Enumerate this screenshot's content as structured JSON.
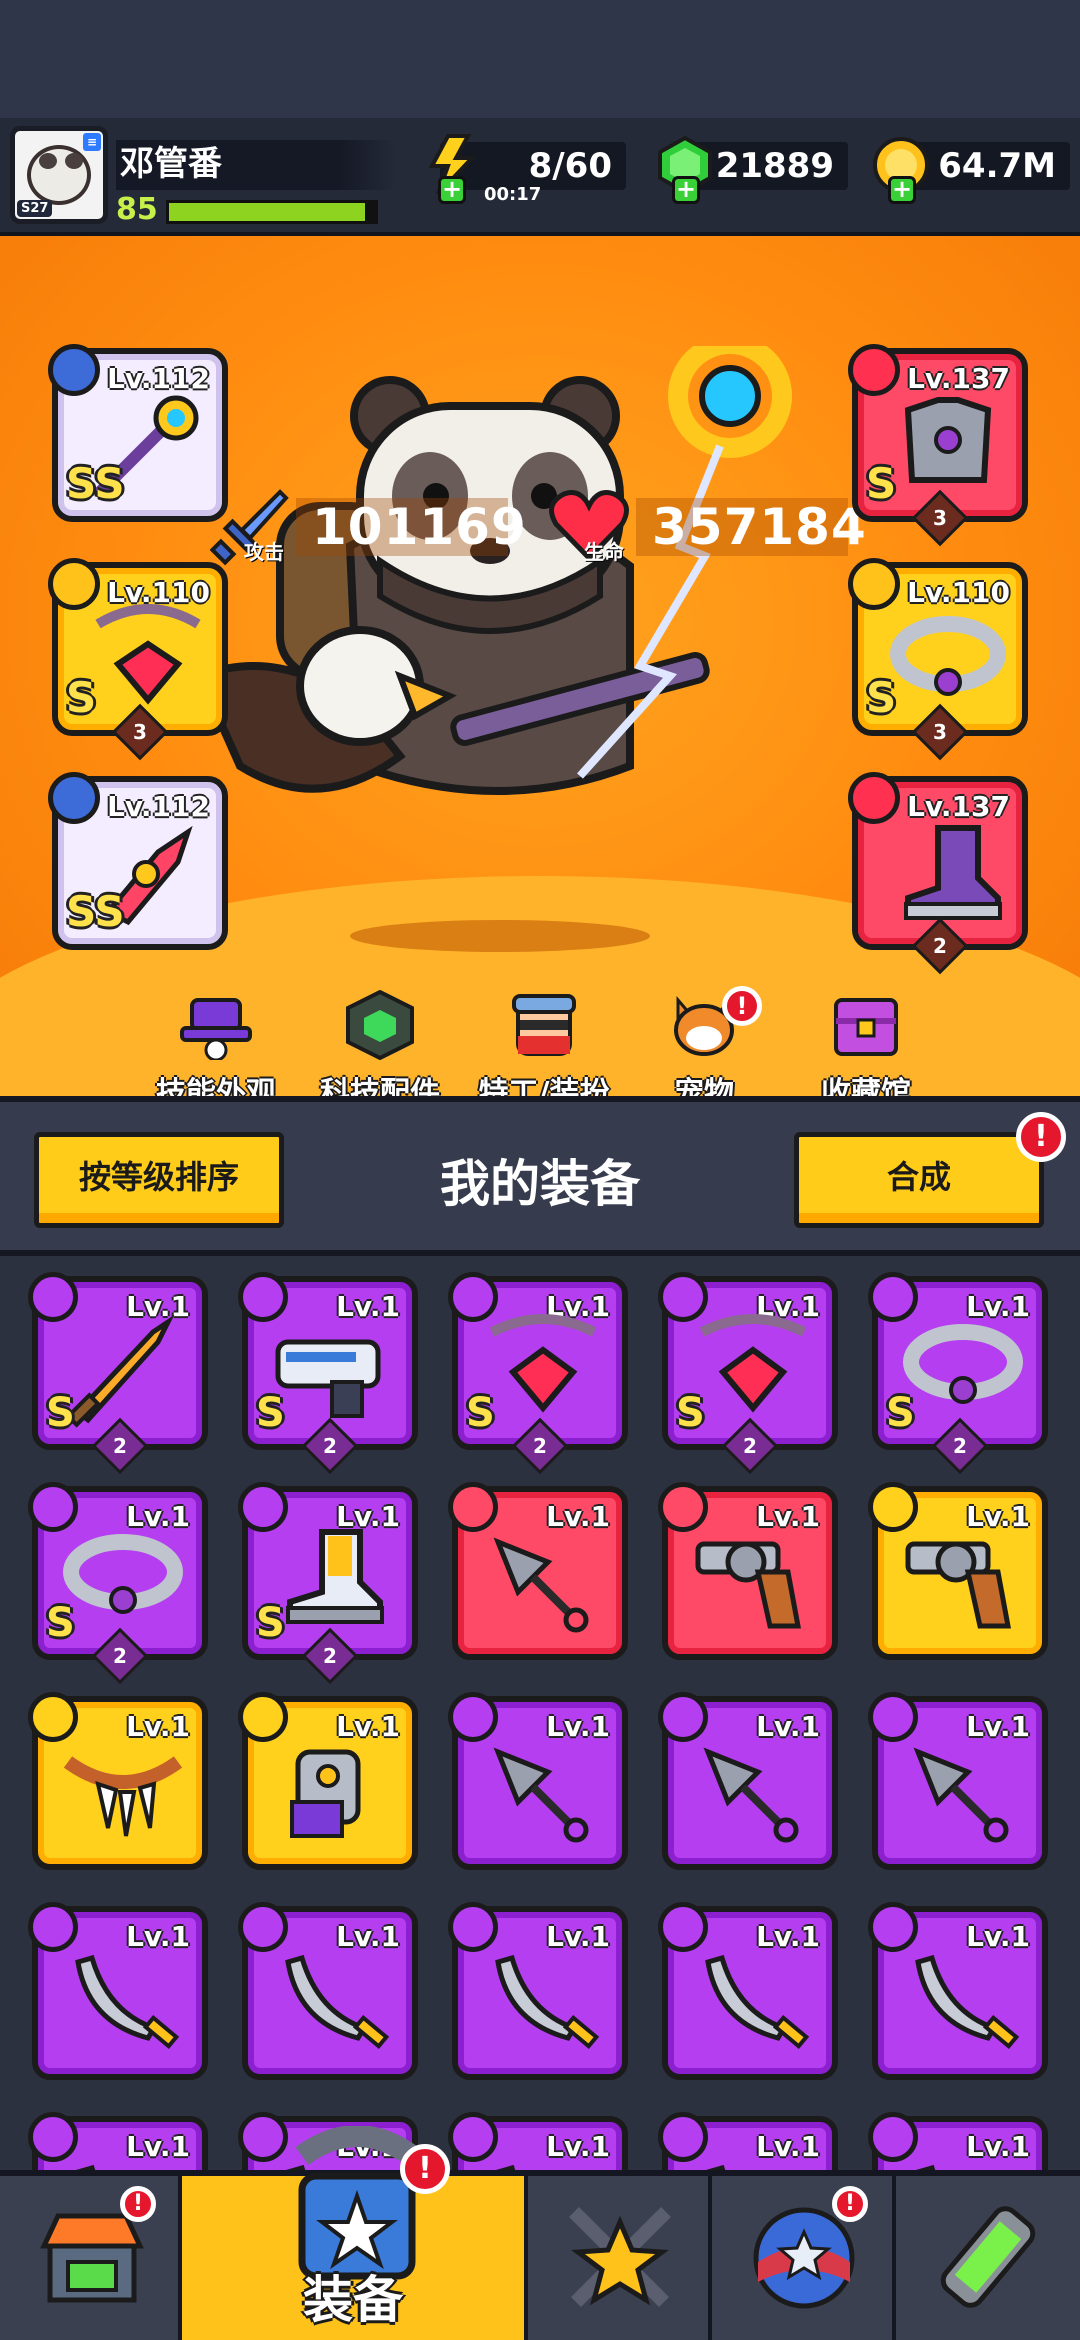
{
  "player": {
    "name": "邓管番",
    "level": "85",
    "server": "S27",
    "xp_fraction": 0.95
  },
  "resources": {
    "energy": "8/60",
    "energy_timer": "00:17",
    "gems": "21889",
    "coins": "64.7M"
  },
  "stats": {
    "attack_label": "攻击",
    "attack_value": "101169",
    "hp_label": "生命",
    "hp_value": "357184"
  },
  "equipped": [
    {
      "slot": "weapon",
      "level": "Lv.112",
      "grade": "SS",
      "rarity": "white",
      "stars": ""
    },
    {
      "slot": "necklace",
      "level": "Lv.110",
      "grade": "S",
      "rarity": "gold",
      "stars": "3"
    },
    {
      "slot": "glove",
      "level": "Lv.112",
      "grade": "SS",
      "rarity": "white",
      "stars": ""
    },
    {
      "slot": "armor",
      "level": "Lv.137",
      "grade": "S",
      "rarity": "red",
      "stars": "3"
    },
    {
      "slot": "belt",
      "level": "Lv.110",
      "grade": "S",
      "rarity": "gold",
      "stars": "3"
    },
    {
      "slot": "boots",
      "level": "Lv.137",
      "grade": "",
      "rarity": "red",
      "stars": "2"
    }
  ],
  "menu": [
    "技能外观",
    "科技配件",
    "特工/装扮",
    "宠物",
    "收藏馆"
  ],
  "inventory": {
    "sort_button": "按等级排序",
    "title": "我的装备",
    "merge_button": "合成",
    "merge_badge": "!",
    "items": [
      {
        "level": "Lv.1",
        "rarity": "purple",
        "grade": "S",
        "stars": "2",
        "icon": "sword-icon"
      },
      {
        "level": "Lv.1",
        "rarity": "purple",
        "grade": "S",
        "stars": "2",
        "icon": "blaster-icon"
      },
      {
        "level": "Lv.1",
        "rarity": "purple",
        "grade": "S",
        "stars": "2",
        "icon": "necklace-icon"
      },
      {
        "level": "Lv.1",
        "rarity": "purple",
        "grade": "S",
        "stars": "2",
        "icon": "necklace-icon"
      },
      {
        "level": "Lv.1",
        "rarity": "purple",
        "grade": "S",
        "stars": "2",
        "icon": "belt-icon"
      },
      {
        "level": "Lv.1",
        "rarity": "purple",
        "grade": "S",
        "stars": "2",
        "icon": "belt-icon"
      },
      {
        "level": "Lv.1",
        "rarity": "purple",
        "grade": "S",
        "stars": "2",
        "icon": "boot-icon"
      },
      {
        "level": "Lv.1",
        "rarity": "red",
        "grade": "",
        "stars": "",
        "icon": "kunai-icon"
      },
      {
        "level": "Lv.1",
        "rarity": "red",
        "grade": "",
        "stars": "",
        "icon": "revolver-icon"
      },
      {
        "level": "Lv.1",
        "rarity": "gold",
        "grade": "",
        "stars": "",
        "icon": "revolver-icon"
      },
      {
        "level": "Lv.1",
        "rarity": "gold",
        "grade": "",
        "stars": "",
        "icon": "fang-necklace-icon"
      },
      {
        "level": "Lv.1",
        "rarity": "gold",
        "grade": "",
        "stars": "",
        "icon": "gauntlet-icon"
      },
      {
        "level": "Lv.1",
        "rarity": "purple",
        "grade": "",
        "stars": "",
        "icon": "kunai-icon"
      },
      {
        "level": "Lv.1",
        "rarity": "purple",
        "grade": "",
        "stars": "",
        "icon": "kunai-icon"
      },
      {
        "level": "Lv.1",
        "rarity": "purple",
        "grade": "",
        "stars": "",
        "icon": "kunai-icon"
      },
      {
        "level": "Lv.1",
        "rarity": "purple",
        "grade": "",
        "stars": "",
        "icon": "scimitar-icon"
      },
      {
        "level": "Lv.1",
        "rarity": "purple",
        "grade": "",
        "stars": "",
        "icon": "scimitar-icon"
      },
      {
        "level": "Lv.1",
        "rarity": "purple",
        "grade": "",
        "stars": "",
        "icon": "scimitar-icon"
      },
      {
        "level": "Lv.1",
        "rarity": "purple",
        "grade": "",
        "stars": "",
        "icon": "scimitar-icon"
      },
      {
        "level": "Lv.1",
        "rarity": "purple",
        "grade": "",
        "stars": "",
        "icon": "scimitar-icon"
      },
      {
        "level": "Lv.1",
        "rarity": "purple",
        "grade": "",
        "stars": "",
        "icon": "scimitar-icon"
      },
      {
        "level": "Lv.1",
        "rarity": "purple",
        "grade": "",
        "stars": "",
        "icon": "scimitar-icon"
      },
      {
        "level": "Lv.1",
        "rarity": "purple",
        "grade": "",
        "stars": "",
        "icon": "scimitar-icon"
      },
      {
        "level": "Lv.1",
        "rarity": "purple",
        "grade": "",
        "stars": "",
        "icon": "scimitar-icon"
      },
      {
        "level": "Lv.1",
        "rarity": "purple",
        "grade": "",
        "stars": "",
        "icon": "scimitar-icon"
      }
    ]
  },
  "nav": {
    "tabs": [
      {
        "name": "shop-tab",
        "label": "",
        "icon": "shop-icon",
        "badge": "!"
      },
      {
        "name": "equipment-tab",
        "label": "装备",
        "icon": "equipment-icon",
        "badge": "!"
      },
      {
        "name": "battle-tab",
        "label": "",
        "icon": "crossed-swords-star-icon",
        "badge": ""
      },
      {
        "name": "pets-tab",
        "label": "",
        "icon": "star-ball-icon",
        "badge": "!"
      },
      {
        "name": "gene-tab",
        "label": "",
        "icon": "dna-tube-icon",
        "badge": ""
      }
    ]
  },
  "colors": {
    "scene_orange": "#ff8c10",
    "gold": "#ffcc1a",
    "purple": "#b43ef0",
    "red": "#ff4a67",
    "badge_red": "#e5172c"
  }
}
